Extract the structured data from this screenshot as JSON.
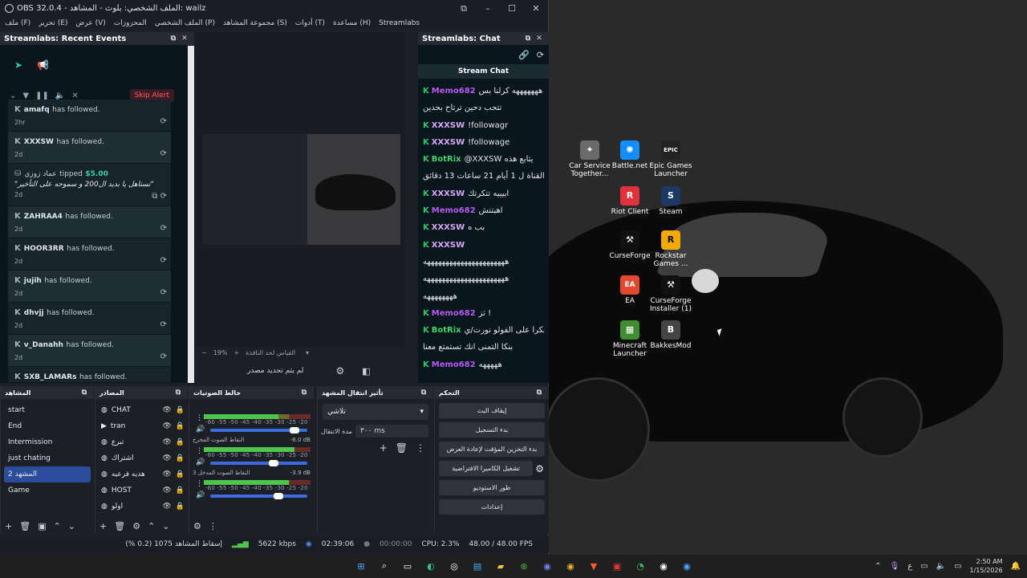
{
  "window": {
    "title": "OBS 32.0.4 - الملف الشخصي: بلوث - المشاهد: wailz",
    "menu": [
      "ملف (F)",
      "تحرير (E)",
      "عرض (V)",
      "المحزوزات",
      "الملف الشخصي (P)",
      "مجموعة المشاهد (S)",
      "أدوات (T)",
      "مساعدة (H)",
      "Streamlabs"
    ]
  },
  "recent_events": {
    "title": "Streamlabs: Recent Events",
    "skip_label": "Skip Alert",
    "items": [
      {
        "user": "amafq",
        "action": "has followed.",
        "time": "2hr"
      },
      {
        "user": "XXXSW",
        "action": "has followed.",
        "time": "2d"
      },
      {
        "user": "عماد زوزي",
        "action": "tipped",
        "amount": "$5.00",
        "message": "\"تستاهل يا بديد ال200 و سموحه على التأخير\"",
        "time": "2d"
      },
      {
        "user": "ZAHRAA4",
        "action": "has followed.",
        "time": "2d"
      },
      {
        "user": "HOOR3RR",
        "action": "has followed.",
        "time": "2d"
      },
      {
        "user": "jujih",
        "action": "has followed.",
        "time": "2d"
      },
      {
        "user": "dhvjj",
        "action": "has followed.",
        "time": "2d"
      },
      {
        "user": "v_Danahh",
        "action": "has followed.",
        "time": "2d"
      },
      {
        "user": "SXB_LAMARs",
        "action": "has followed.",
        "time": ""
      }
    ]
  },
  "preview": {
    "zoom": "19%",
    "zoom_hint": "القياس لحد النافذة",
    "no_source_label": "لم يتم تحديد مصدر"
  },
  "chat": {
    "dock_title": "Streamlabs: Chat",
    "header": "Stream Chat",
    "messages": [
      {
        "user": "Memo682",
        "color": "#b65cf2",
        "text": "هههههههه كرلنا بس"
      },
      {
        "user": "",
        "color": "#e2e7ea",
        "text": "تتحب دحين ترتاح بحدين"
      },
      {
        "user": "XXXSW",
        "color": "#d9a5f7",
        "text": "!followagr"
      },
      {
        "user": "XXXSW",
        "color": "#d9a5f7",
        "text": "!followage"
      },
      {
        "user": "BotRix",
        "color": "#43d36b",
        "text": "@XXXSW يتابع هذه"
      },
      {
        "user": "",
        "color": "#e2e7ea",
        "text": "القناة ل 1 أيام 21 ساعات 13 دقائق !"
      },
      {
        "user": "XXXSW",
        "color": "#d9a5f7",
        "text": "ابيييه تتكرتك"
      },
      {
        "user": "Memo682",
        "color": "#b65cf2",
        "text": "اهبتنش"
      },
      {
        "user": "XXXSW",
        "color": "#d9a5f7",
        "text": "بب ه"
      },
      {
        "user": "XXXSW",
        "color": "#d9a5f7",
        "text": ""
      },
      {
        "user": "",
        "color": "#e2e7ea",
        "text": "ههههههههههههههههههههههه"
      },
      {
        "user": "",
        "color": "#e2e7ea",
        "text": "ههههههههههههههههههههههه"
      },
      {
        "user": "",
        "color": "#e2e7ea",
        "text": "ههههههههه"
      },
      {
        "user": "Memo682",
        "color": "#b65cf2",
        "text": "تز !"
      },
      {
        "user": "BotRix",
        "color": "#43d36b",
        "text": "شكرا على الفولو نورت/ي"
      },
      {
        "user": "",
        "color": "#e2e7ea",
        "text": "بنكا التمنى انك تستمتع معنا"
      },
      {
        "user": "Memo682",
        "color": "#b65cf2",
        "text": "هههههه"
      }
    ]
  },
  "scenes": {
    "title": "المشاهد",
    "items": [
      "start",
      "End",
      "Intermission",
      "just chating",
      "المشهد 2",
      "Game"
    ],
    "selected": 4
  },
  "sources": {
    "title": "المصادر",
    "items": [
      "CHAT",
      "tran",
      "تبرع",
      "اشتراك",
      "هديه فرعيه",
      "HOST",
      "اولو"
    ]
  },
  "mixer": {
    "title": "خالط الصوتيات",
    "scale": "-60 -55 -50 -45 -40 -35 -30 -25 -20 -15 -10 -5 0",
    "channels": [
      {
        "name": "",
        "db": "",
        "level": 0.7,
        "volume": 0.92
      },
      {
        "name": "التقاط الصوت المخرج",
        "db": "-6.0 dB",
        "level": 0.85,
        "volume": 0.7
      },
      {
        "name": "التقاط الصوت المدخل 3",
        "db": "-3.9 dB",
        "level": 0.8,
        "volume": 0.75
      }
    ]
  },
  "transitions": {
    "title": "تأثير انتقال المشهد",
    "selected": "تلاشي",
    "duration_label": "مدة الانتقال",
    "duration": "٣٠٠ ms"
  },
  "controls": {
    "title": "التحكم",
    "buttons": [
      "إيقاف البث",
      "بدء التسجيل",
      "بدء التخزين المؤقت لإعادة العرض",
      "تشغيل الكاميرا الافتراضية",
      "طور الاستوديو",
      "إعدادات"
    ]
  },
  "status": {
    "dropped": "إسقاط المشاهد 1075 (0.2 %)",
    "bitrate": "5622 kbps",
    "live_time": "02:39:06",
    "rec_time": "00:00:00",
    "cpu": "CPU: 2.3%",
    "fps": "48.00 / 48.00 FPS"
  },
  "desktop_icons": [
    {
      "label": "Car Service Together...",
      "color": "#6a6a6a",
      "glyph": "✦"
    },
    {
      "label": "Battle.net",
      "color": "#148eff",
      "glyph": "✺"
    },
    {
      "label": "Epic Games Launcher",
      "color": "#222222",
      "glyph": "EPIC"
    },
    {
      "label": "Riot Client",
      "color": "#e0313d",
      "glyph": "R"
    },
    {
      "label": "Steam",
      "color": "#1b3b66",
      "glyph": "S"
    },
    {
      "label": "CurseForge",
      "color": "#111111",
      "glyph": "⚒"
    },
    {
      "label": "Rockstar Games ...",
      "color": "#f2a900",
      "glyph": "R"
    },
    {
      "label": "EA",
      "color": "#e24a2f",
      "glyph": "EA"
    },
    {
      "label": "CurseForge Installer (1)",
      "color": "#111111",
      "glyph": "⚒"
    },
    {
      "label": "Minecraft Launcher",
      "color": "#3f8d2e",
      "glyph": "▦"
    },
    {
      "label": "BakkesMod",
      "color": "#444444",
      "glyph": "B"
    }
  ],
  "tray": {
    "lang": "ع",
    "time": "2:50 AM",
    "date": "1/15/2026"
  }
}
